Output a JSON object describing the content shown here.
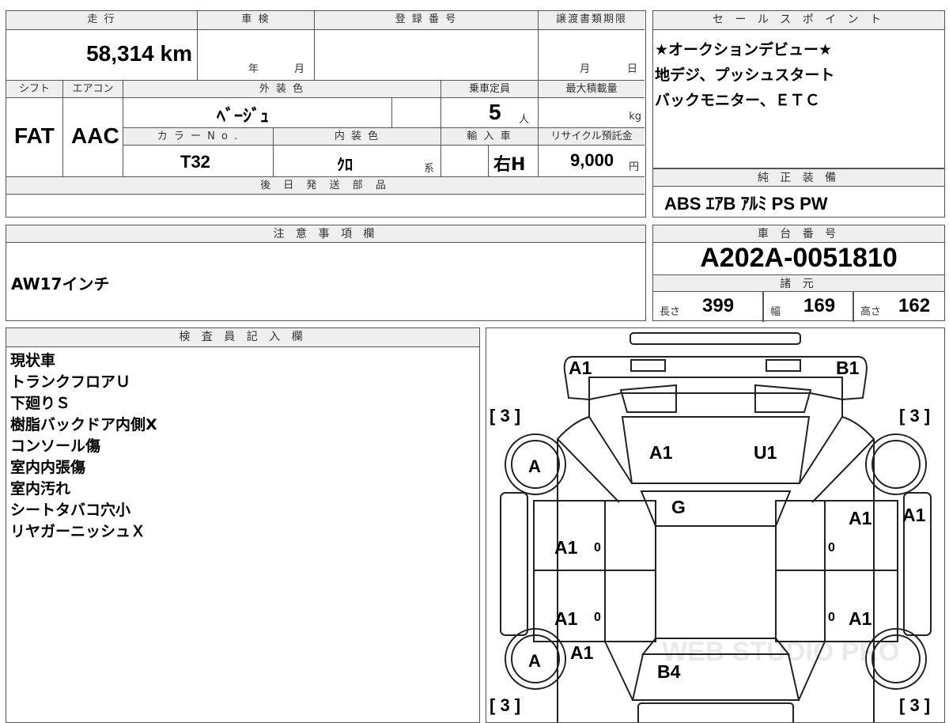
{
  "top": {
    "mileage_hdr": "走 行",
    "inspection_hdr": "車 検",
    "reg_hdr": "登 録 番 号",
    "transfer_hdr": "譲渡書類期限",
    "mileage": "58,314 km",
    "year_lbl": "年",
    "month_lbl": "月",
    "t_month": "月",
    "t_day": "日",
    "shift_hdr": "シフト",
    "ac_hdr": "エアコン",
    "ext_hdr": "外 装 色",
    "cap_hdr": "乗車定員",
    "load_hdr": "最大積載量",
    "shift": "FAT",
    "ac": "AAC",
    "ext_color": "ﾍﾞｰｼﾞｭ",
    "capacity": "5",
    "cap_unit": "人",
    "load_unit": "kg",
    "color_no_hdr": "カ ラ ー N o .",
    "int_hdr": "内 装 色",
    "import_hdr": "輸 入 車",
    "recycle_hdr": "リサイクル預託金",
    "color_no": "T32",
    "int_color": "ｸﾛ",
    "int_suffix": "系",
    "steering": "右H",
    "recycle": "9,000",
    "recycle_unit": "円",
    "later_parts_hdr": "後 日 発 送 部 品"
  },
  "sales": {
    "hdr": "セ ー ル ス ポ イ ン ト",
    "lines": [
      "★オークションデビュー★",
      "地デジ、プッシュスタート",
      "バックモニター、ＥＴＣ"
    ]
  },
  "equipment": {
    "hdr": "純 正 装 備",
    "items": "ABS ｴｱB ｱﾙﾐ PS PW"
  },
  "notes": {
    "hdr": "注 意 事 項 欄",
    "text": "AW17インチ"
  },
  "chassis": {
    "hdr": "車 台 番 号",
    "number": "A202A-0051810",
    "spec_hdr": "諸 元",
    "length_lbl": "長さ",
    "length": "399",
    "width_lbl": "幅",
    "width": "169",
    "height_lbl": "高さ",
    "height": "162"
  },
  "inspector": {
    "hdr": "検 査 員 記 入 欄",
    "lines": [
      "現状車",
      "トランクフロアＵ",
      "下廻りＳ",
      "樹脂バックドア内側X",
      "コンソール傷",
      "室内内張傷",
      "室内汚れ",
      "シートタバコ穴小",
      "リヤガーニッシュＸ"
    ]
  },
  "diagram": {
    "tire_front_left": "[ 3 ]",
    "tire_front_right": "[ 3 ]",
    "tire_rear_left": "[ 3 ]",
    "tire_rear_right": "[ 3 ]",
    "wheel_fl": "A",
    "wheel_rl": "A",
    "front_bumper_left": "A1",
    "front_bumper_right": "B1",
    "hood_left": "A1",
    "hood_right": "U1",
    "windshield": "G",
    "fender_right_front": "A1",
    "door_right_front_outer": "A1",
    "door_left_front": "A1",
    "door_left_front_num": "0",
    "door_right_front_num": "0",
    "door_left_rear": "A1",
    "door_left_rear_num": "0",
    "door_right_rear": "A1",
    "door_right_rear_num": "0",
    "quarter_left": "A1",
    "rear": "B4",
    "watermark": "WEB STUDIO PRO"
  }
}
